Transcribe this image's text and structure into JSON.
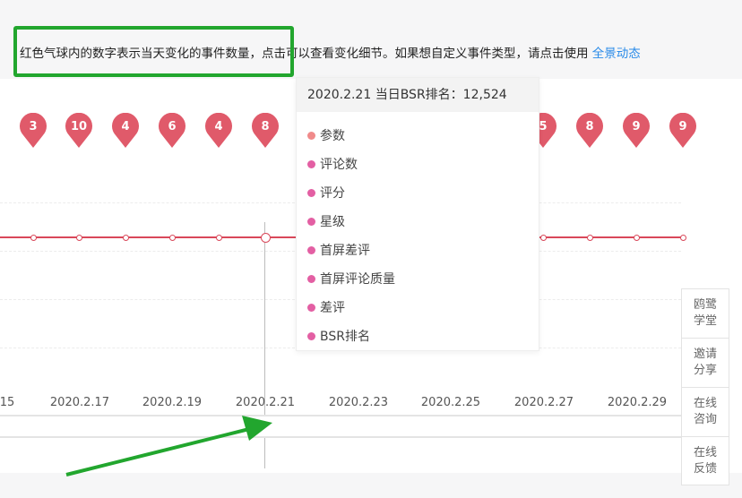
{
  "notice": {
    "text": "红色气球内的数字表示当天变化的事件数量，点击可以查看变化细节。如果想自定义事件类型，请点击使用",
    "link": "全景动态"
  },
  "chart": {
    "balloons": [
      "3",
      "10",
      "4",
      "6",
      "4",
      "8",
      "5",
      "8",
      "9",
      "9"
    ],
    "x_ticks": [
      "15",
      "2020.2.17",
      "2020.2.19",
      "2020.2.21",
      "2020.2.23",
      "2020.2.25",
      "2020.2.27",
      "2020.2.29"
    ]
  },
  "tooltip": {
    "header": "2020.2.21 当日BSR排名：12,524",
    "items": [
      {
        "label": "参数",
        "color": "#f08a8a"
      },
      {
        "label": "评论数",
        "color": "#e35fa3"
      },
      {
        "label": "评分",
        "color": "#e35fa3"
      },
      {
        "label": "星级",
        "color": "#e35fa3"
      },
      {
        "label": "首屏差评",
        "color": "#e35fa3"
      },
      {
        "label": "首屏评论质量",
        "color": "#e35fa3"
      },
      {
        "label": "差评",
        "color": "#e35fa3"
      },
      {
        "label": "BSR排名",
        "color": "#e35fa3"
      }
    ]
  },
  "side_panel": [
    "鸥鹭学堂",
    "邀请分享",
    "在线咨询",
    "在线反馈"
  ],
  "colors": {
    "balloon": "#e05a6a",
    "series_line": "#d9485a",
    "highlight_box": "#22a62e",
    "arrow": "#22a62e",
    "link": "#2a8be8"
  }
}
